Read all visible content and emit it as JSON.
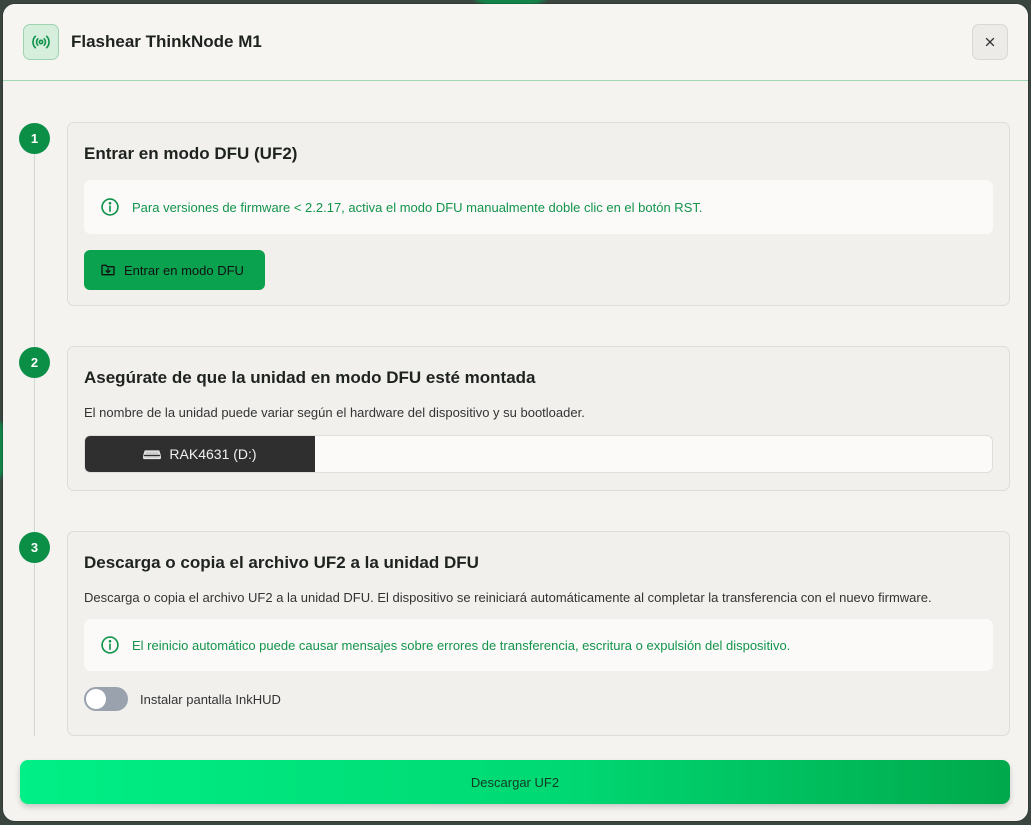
{
  "modal": {
    "title": "Flashear ThinkNode M1",
    "header_icon": "radio-broadcast-icon",
    "close_icon": "close-icon"
  },
  "steps": [
    {
      "number": "1",
      "title": "Entrar en modo DFU (UF2)",
      "info": "Para versiones de firmware < 2.2.17, activa el modo DFU manualmente doble clic en el botón RST.",
      "button_label": "Entrar en modo DFU"
    },
    {
      "number": "2",
      "title": "Asegúrate de que la unidad en modo DFU esté montada",
      "description": "El nombre de la unidad puede variar según el hardware del dispositivo y su bootloader.",
      "drive_label": "RAK4631 (D:)"
    },
    {
      "number": "3",
      "title": "Descarga o copia el archivo UF2 a la unidad DFU",
      "description": "Descarga o copia el archivo UF2 a la unidad DFU. El dispositivo se reiniciará automáticamente al completar la transferencia con el nuevo firmware.",
      "info": "El reinicio automático puede causar mensajes sobre errores de transferencia, escritura o expulsión del dispositivo.",
      "toggle_label": "Instalar pantalla InkHUD",
      "toggle_on": false
    }
  ],
  "download_label": "Descargar UF2",
  "colors": {
    "accent": "#0aa14f",
    "step_badge": "#0b8f46",
    "info_text": "#12944d"
  }
}
